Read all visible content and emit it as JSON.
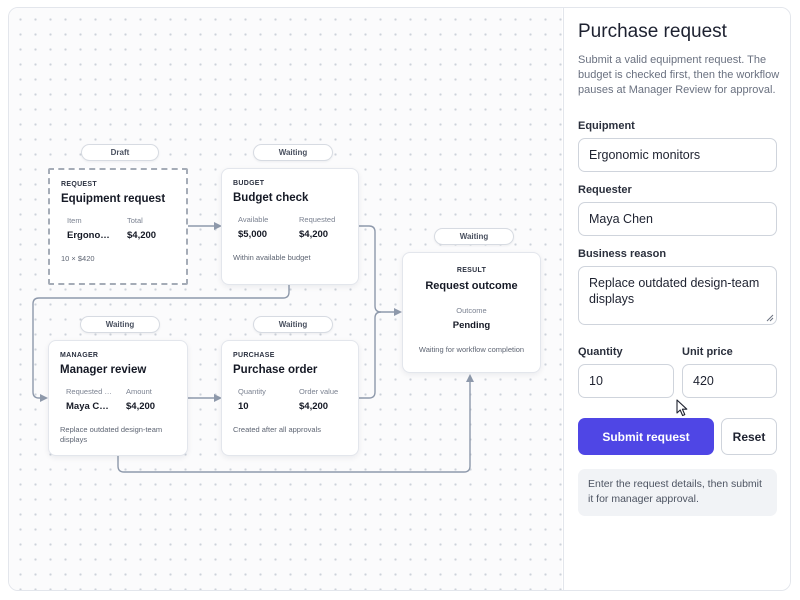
{
  "nodes": {
    "request": {
      "status": "Draft",
      "kicker": "REQUEST",
      "title": "Equipment request",
      "fields": [
        {
          "label": "Item",
          "value": "Ergonomic monitors"
        },
        {
          "label": "Total",
          "value": "$4,200"
        }
      ],
      "footnote": "10 × $420"
    },
    "budget": {
      "status": "Waiting",
      "kicker": "BUDGET",
      "title": "Budget check",
      "fields": [
        {
          "label": "Available",
          "value": "$5,000"
        },
        {
          "label": "Requested",
          "value": "$4,200"
        }
      ],
      "footnote": "Within available budget"
    },
    "manager": {
      "status": "Waiting",
      "kicker": "MANAGER",
      "title": "Manager review",
      "fields": [
        {
          "label": "Requested by",
          "value": "Maya Chen"
        },
        {
          "label": "Amount",
          "value": "$4,200"
        }
      ],
      "footnote": "Replace outdated design-team displays"
    },
    "purchase": {
      "status": "Waiting",
      "kicker": "PURCHASE",
      "title": "Purchase order",
      "fields": [
        {
          "label": "Quantity",
          "value": "10"
        },
        {
          "label": "Order value",
          "value": "$4,200"
        }
      ],
      "footnote": "Created after all approvals"
    },
    "result": {
      "status": "Waiting",
      "kicker": "RESULT",
      "title": "Request outcome",
      "field": {
        "label": "Outcome",
        "value": "Pending"
      },
      "footnote": "Waiting for workflow completion"
    }
  },
  "panel": {
    "title": "Purchase request",
    "description": "Submit a valid equipment request. The budget is checked first, then the workflow pauses at Manager Review for approval.",
    "equipment": {
      "label": "Equipment",
      "value": "Ergonomic monitors"
    },
    "requester": {
      "label": "Requester",
      "value": "Maya Chen"
    },
    "reason": {
      "label": "Business reason",
      "value": "Replace outdated design-team displays"
    },
    "quantity": {
      "label": "Quantity",
      "value": "10"
    },
    "unit_price": {
      "label": "Unit price",
      "value": "420"
    },
    "submit_label": "Submit request",
    "reset_label": "Reset",
    "notice": "Enter the request details, then submit it for manager approval."
  },
  "icons": {
    "cursor": "mouse-pointer-icon",
    "resize": "textarea-resize-icon",
    "arrow": "arrowhead-icon"
  },
  "colors": {
    "accent": "#4f46e5",
    "edge": "#8e99ab",
    "border": "#e3e6ec"
  }
}
